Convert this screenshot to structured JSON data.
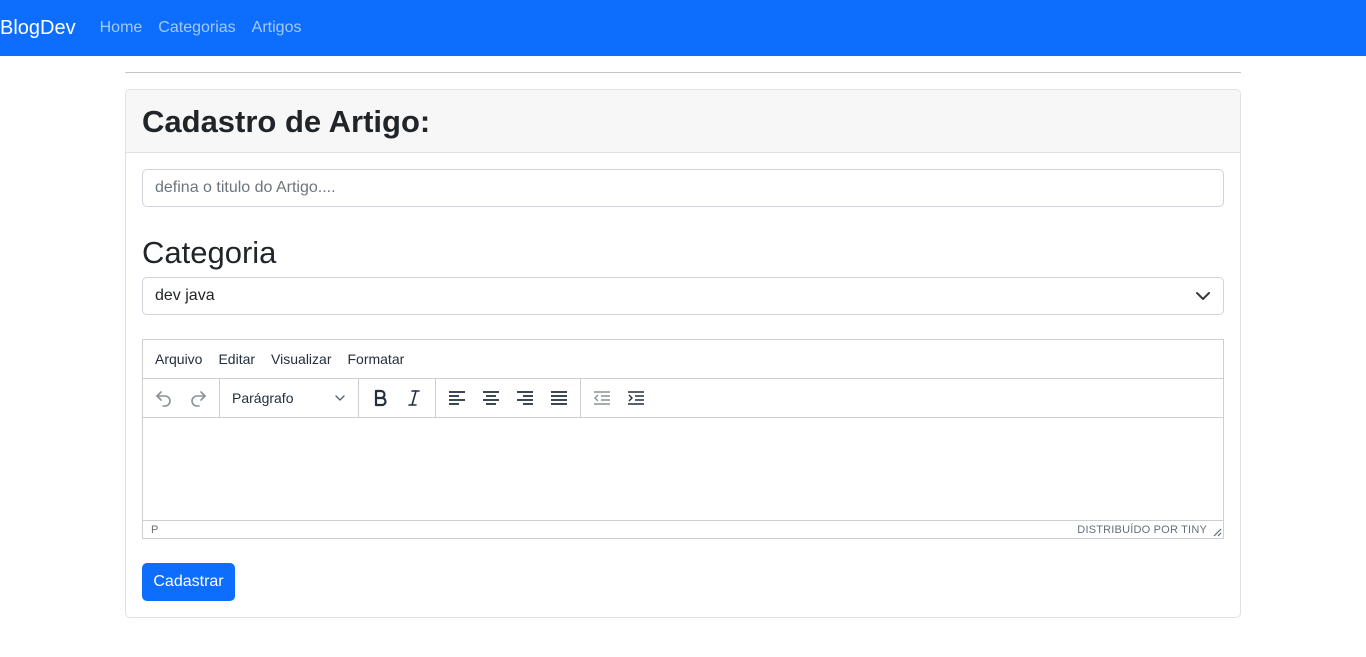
{
  "navbar": {
    "brand": "BlogDev",
    "links": [
      {
        "label": "Home"
      },
      {
        "label": "Categorias"
      },
      {
        "label": "Artigos"
      }
    ],
    "bg_color": "#0d6efd"
  },
  "card": {
    "title": "Cadastro de Artigo:",
    "title_input": {
      "value": "",
      "placeholder": "defina o titulo do Artigo...."
    },
    "category_heading": "Categoria",
    "category_select": {
      "selected": "dev java"
    },
    "editor": {
      "menus": [
        "Arquivo",
        "Editar",
        "Visualizar",
        "Formatar"
      ],
      "block_format": "Parágrafo",
      "status_path": "P",
      "branding": "DISTRIBUÍDO POR TINY",
      "toolbar_icons": [
        "undo-icon",
        "redo-icon",
        "bold-icon",
        "italic-icon",
        "align-left-icon",
        "align-center-icon",
        "align-right-icon",
        "align-justify-icon",
        "outdent-icon",
        "indent-icon"
      ]
    },
    "submit_label": "Cadastrar"
  }
}
